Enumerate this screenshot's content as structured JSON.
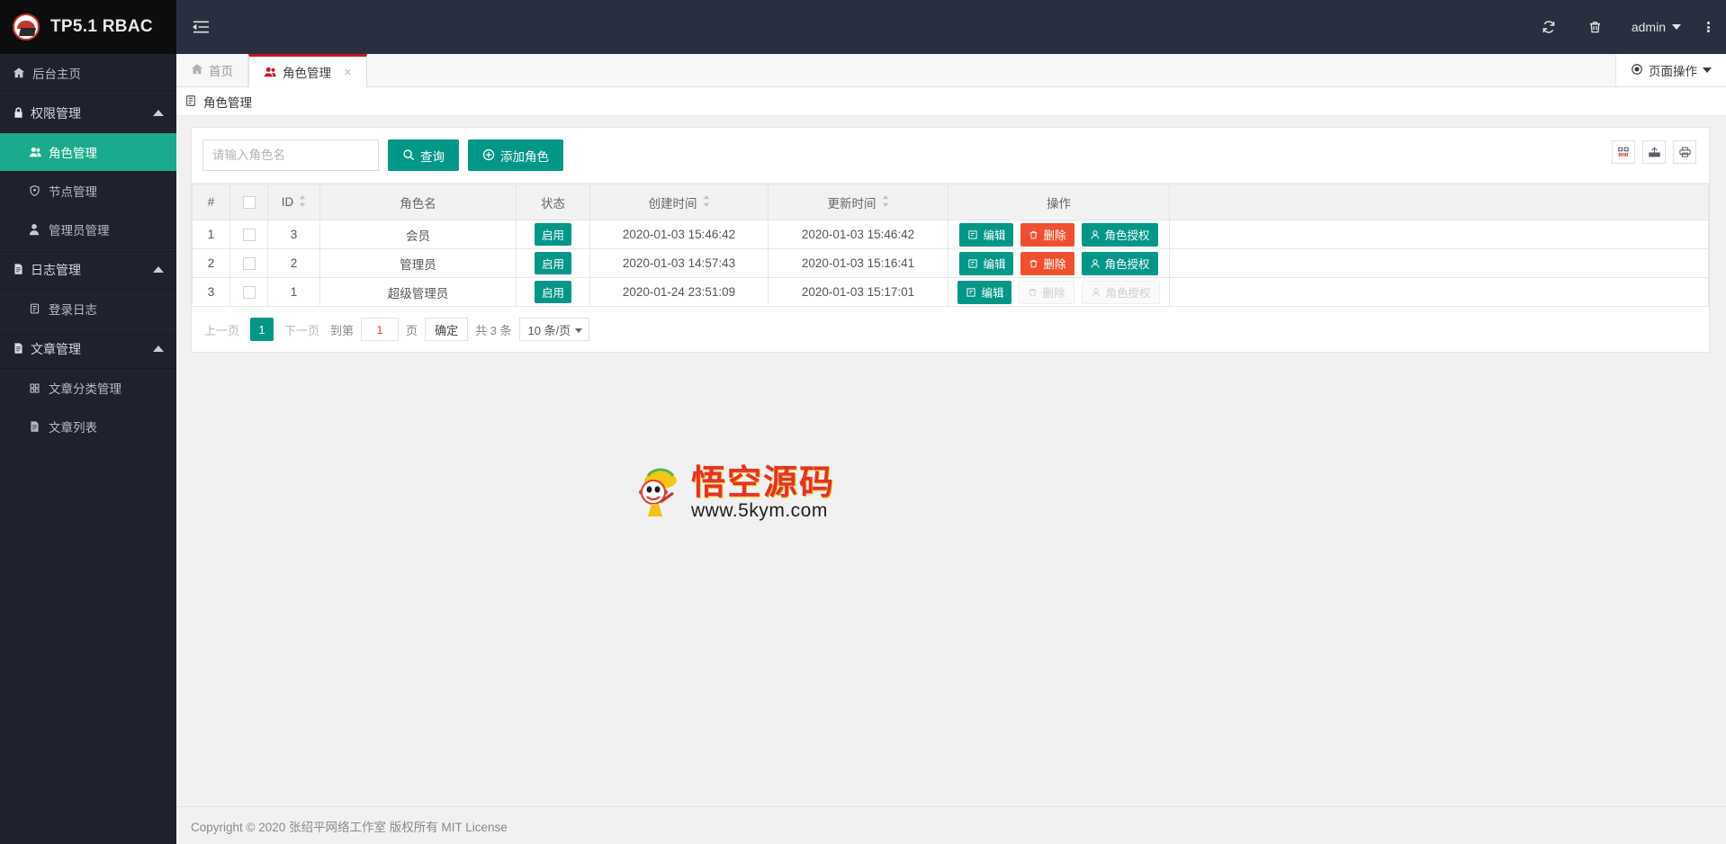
{
  "app": {
    "brand": "TP5.1 RBAC",
    "logo_icon": "tp-logo-icon"
  },
  "header": {
    "collapse_icon": "menu-collapse-icon",
    "refresh_icon": "refresh-icon",
    "trash_icon": "trash-icon",
    "user_name": "admin",
    "user_caret_icon": "chevron-down-icon",
    "more_icon": "vertical-dots-icon"
  },
  "sidebar": {
    "items": [
      {
        "label": "后台主页",
        "icon": "home-icon",
        "type": "link",
        "active": false
      },
      {
        "label": "权限管理",
        "icon": "lock-icon",
        "type": "group",
        "expanded": true
      },
      {
        "label": "角色管理",
        "icon": "users-icon",
        "type": "child",
        "active": true
      },
      {
        "label": "节点管理",
        "icon": "shield-icon",
        "type": "child",
        "active": false
      },
      {
        "label": "管理员管理",
        "icon": "user-icon",
        "type": "child",
        "active": false
      },
      {
        "label": "日志管理",
        "icon": "file-text-icon",
        "type": "group",
        "expanded": true
      },
      {
        "label": "登录日志",
        "icon": "notebook-icon",
        "type": "child",
        "active": false
      },
      {
        "label": "文章管理",
        "icon": "file-text-icon",
        "type": "group",
        "expanded": true
      },
      {
        "label": "文章分类管理",
        "icon": "grid-icon",
        "type": "child",
        "active": false
      },
      {
        "label": "文章列表",
        "icon": "file-icon",
        "type": "child",
        "active": false
      }
    ]
  },
  "tabs": {
    "items": [
      {
        "label": "首页",
        "icon": "home-icon",
        "active": false,
        "closable": false
      },
      {
        "label": "角色管理",
        "icon": "users-icon",
        "active": true,
        "closable": true
      }
    ],
    "close_glyph": "×",
    "page_actions_label": "页面操作",
    "page_actions_icon": "target-icon"
  },
  "page": {
    "title": "角色管理",
    "title_icon": "notebook-icon"
  },
  "search": {
    "placeholder": "请输入角色名",
    "value": "",
    "search_label": "查询",
    "search_icon": "search-icon",
    "add_label": "添加角色",
    "add_icon": "plus-circle-icon"
  },
  "toolbar_icons": [
    {
      "name": "columns-toggle-icon",
      "glyph": "columns"
    },
    {
      "name": "export-icon",
      "glyph": "export"
    },
    {
      "name": "print-icon",
      "glyph": "print"
    }
  ],
  "table": {
    "columns": [
      {
        "label": "#",
        "sortable": false,
        "key": "index"
      },
      {
        "label": "",
        "sortable": false,
        "key": "check"
      },
      {
        "label": "ID",
        "sortable": true,
        "key": "id"
      },
      {
        "label": "角色名",
        "sortable": false,
        "key": "name"
      },
      {
        "label": "状态",
        "sortable": false,
        "key": "status"
      },
      {
        "label": "创建时间",
        "sortable": true,
        "key": "created"
      },
      {
        "label": "更新时间",
        "sortable": true,
        "key": "updated"
      },
      {
        "label": "操作",
        "sortable": false,
        "key": "ops"
      }
    ],
    "rows": [
      {
        "index": "1",
        "id": "3",
        "name": "会员",
        "status": "启用",
        "created": "2020-01-03 15:46:42",
        "updated": "2020-01-03 15:46:42",
        "ops": {
          "edit": "编辑",
          "delete": "删除",
          "auth": "角色授权",
          "disabled": false
        }
      },
      {
        "index": "2",
        "id": "2",
        "name": "管理员",
        "status": "启用",
        "created": "2020-01-03 14:57:43",
        "updated": "2020-01-03 15:16:41",
        "ops": {
          "edit": "编辑",
          "delete": "删除",
          "auth": "角色授权",
          "disabled": false
        }
      },
      {
        "index": "3",
        "id": "1",
        "name": "超级管理员",
        "status": "启用",
        "created": "2020-01-24 23:51:09",
        "updated": "2020-01-03 15:17:01",
        "ops": {
          "edit": "编辑",
          "delete": "删除",
          "auth": "角色授权",
          "disabled": true
        }
      }
    ]
  },
  "pagination": {
    "prev": "上一页",
    "current": "1",
    "next": "下一页",
    "goto_prefix": "到第",
    "goto_value": "1",
    "goto_suffix": "页",
    "confirm": "确定",
    "total": "共 3 条",
    "page_size": "10 条/页"
  },
  "watermark": {
    "cn": "悟空源码",
    "url": "www.5kym.com"
  },
  "footer": {
    "text": "Copyright © 2020 张绍平网络工作室 版权所有 MIT License"
  },
  "colors": {
    "accent": "#009688",
    "sidebar_active": "#1aab8a",
    "tab_active_border": "#c0172b",
    "danger": "#f0502f",
    "sidebar_bg": "#1e222d",
    "topbar_bg": "#2a2f3e"
  }
}
